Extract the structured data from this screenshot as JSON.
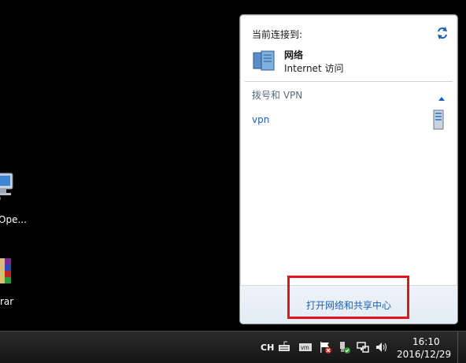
{
  "desktop": {
    "icons": [
      {
        "label": "Ope...",
        "icon": "network-computer-icon"
      },
      {
        "label": "rar",
        "icon": "winrar-icon"
      }
    ]
  },
  "flyout": {
    "connected_title": "当前连接到:",
    "network": {
      "name": "网络",
      "access": "Internet 访问"
    },
    "section_title": "拨号和 VPN",
    "vpn_entries": [
      {
        "name": "vpn"
      }
    ],
    "footer_link": "打开网络和共享中心"
  },
  "taskbar": {
    "language": "CH",
    "tray_icons": [
      "keyboard-icon",
      "vmware-icon",
      "action-center-flag-icon",
      "safely-remove-usb-icon",
      "network-icon",
      "volume-icon"
    ],
    "clock": {
      "time": "16:10",
      "date": "2016/12/29"
    }
  },
  "colors": {
    "link": "#1c63b7",
    "highlight": "#e3141a",
    "taskbar": "#1c1c1c"
  }
}
